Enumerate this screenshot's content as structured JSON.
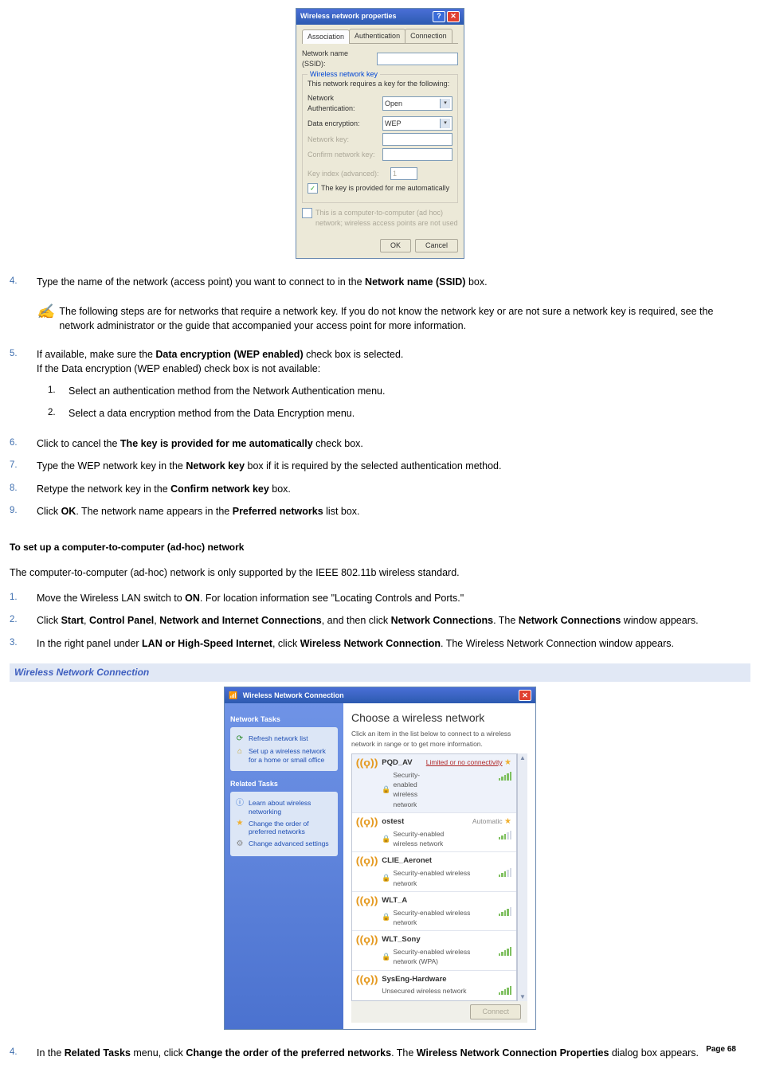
{
  "dialog1": {
    "title": "Wireless network properties",
    "tabs": [
      "Association",
      "Authentication",
      "Connection"
    ],
    "row_ssid_label": "Network name (SSID):",
    "group_title": "Wireless network key",
    "group_sub": "This network requires a key for the following:",
    "row_auth_label": "Network Authentication:",
    "row_auth_value": "Open",
    "row_enc_label": "Data encryption:",
    "row_enc_value": "WEP",
    "row_key_label": "Network key:",
    "row_confirm_label": "Confirm network key:",
    "row_index_label": "Key index (advanced):",
    "row_index_value": "1",
    "chk_auto": "The key is provided for me automatically",
    "chk_adhoc": "This is a computer-to-computer (ad hoc) network; wireless access points are not used",
    "btn_ok": "OK",
    "btn_cancel": "Cancel"
  },
  "steps_a": {
    "s4": {
      "num": "4.",
      "pre": "Type the name of the network (access point) you want to connect to in the ",
      "bold": "Network name (SSID)",
      "post": " box."
    },
    "note": "The following steps are for networks that require a network key. If you do not know the network key or are not sure a network key is required, see the network administrator or the guide that accompanied your access point for more information.",
    "s5": {
      "num": "5.",
      "line1_pre": "If available, make sure the ",
      "line1_bold": "Data encryption (WEP enabled)",
      "line1_post": " check box is selected.",
      "line2": "If the Data encryption (WEP enabled) check box is not available:",
      "sub1": {
        "num": "1.",
        "text": "Select an authentication method from the Network Authentication menu."
      },
      "sub2": {
        "num": "2.",
        "text": "Select a data encryption method from the Data Encryption menu."
      }
    },
    "s6": {
      "num": "6.",
      "pre": "Click to cancel the ",
      "bold": "The key is provided for me automatically",
      "post": " check box."
    },
    "s7": {
      "num": "7.",
      "pre": "Type the WEP network key in the ",
      "bold": "Network key",
      "post": " box if it is required by the selected authentication method."
    },
    "s8": {
      "num": "8.",
      "pre": "Retype the network key in the ",
      "bold": "Confirm network key",
      "post": " box."
    },
    "s9": {
      "num": "9.",
      "pre1": "Click ",
      "b1": "OK",
      "mid": ". The network name appears in the ",
      "b2": "Preferred networks",
      "post": " list box."
    }
  },
  "adhoc": {
    "heading": "To set up a computer-to-computer (ad-hoc) network",
    "intro": "The computer-to-computer (ad-hoc) network is only supported by the IEEE 802.11b wireless standard.",
    "s1": {
      "num": "1.",
      "pre": "Move the Wireless LAN switch to ",
      "bold": "ON",
      "post": ". For location information see \"Locating Controls and Ports.\""
    },
    "s2": {
      "num": "2.",
      "p1": "Click ",
      "b1": "Start",
      "c1": ", ",
      "b2": "Control Panel",
      "c2": ", ",
      "b3": "Network and Internet Connections",
      "c3": ", and then click ",
      "b4": "Network Connections",
      "p2": ". The ",
      "b5": "Network Connections",
      "p3": " window appears."
    },
    "s3": {
      "num": "3.",
      "p1": "In the right panel under ",
      "b1": "LAN or High-Speed Internet",
      "p2": ", click ",
      "b2": "Wireless Network Connection",
      "p3": ". The Wireless Network Connection window appears."
    }
  },
  "caption": "Wireless Network Connection",
  "wnc": {
    "title": "Wireless Network Connection",
    "sidebar": {
      "h1": "Network Tasks",
      "t1": "Refresh network list",
      "t2": "Set up a wireless network for a home or small office",
      "h2": "Related Tasks",
      "t3": "Learn about wireless networking",
      "t4": "Change the order of preferred networks",
      "t5": "Change advanced settings"
    },
    "main_heading": "Choose a wireless network",
    "main_sub": "Click an item in the list below to connect to a wireless network in range or to get more information.",
    "sec_label": "Security-enabled wireless network",
    "sec_label_wpa": "Security-enabled wireless network (WPA)",
    "unsec_label": "Unsecured wireless network",
    "status_limited": "Limited or no connectivity",
    "status_auto": "Automatic",
    "nets": {
      "n1": "PQD_AV",
      "n2": "ostest",
      "n3": "CLIE_Aeronet",
      "n4": "WLT_A",
      "n5": "WLT_Sony",
      "n6": "SysEng-Hardware"
    },
    "connect": "Connect"
  },
  "steps_b": {
    "s4": {
      "num": "4.",
      "p1": "In the ",
      "b1": "Related Tasks",
      "p2": " menu, click ",
      "b2": "Change the order of the preferred networks",
      "p3": ". The ",
      "b3": "Wireless Network Connection Properties",
      "p4": " dialog box appears."
    }
  },
  "page_num": "Page 68"
}
